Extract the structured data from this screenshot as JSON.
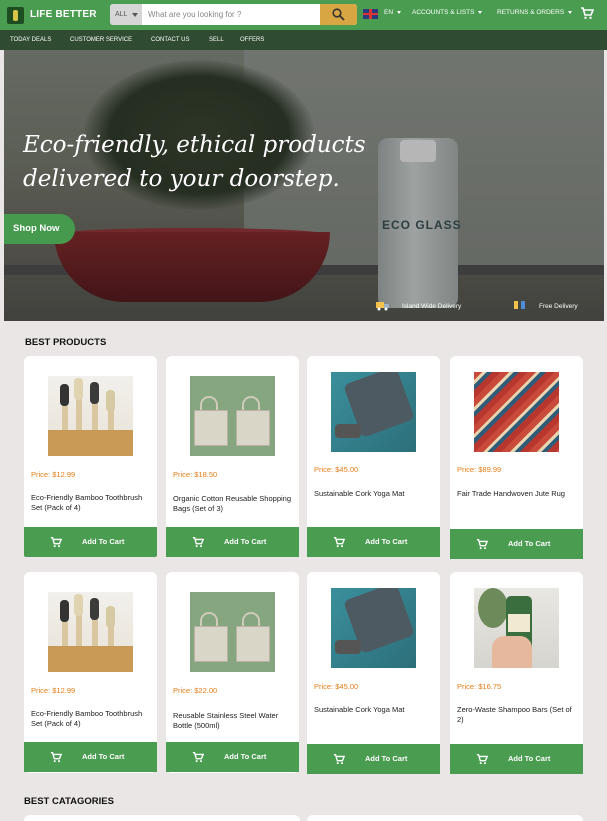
{
  "header": {
    "brand": "LIFE BETTER",
    "search_category": "ALL",
    "search_placeholder": "What are you looking for ?",
    "language": "EN",
    "accounts_label": "ACCOUNTS & LISTS",
    "returns_label": "RETURNS & ORDERS"
  },
  "nav": {
    "items": [
      "TODAY DEALS",
      "CUSTOMER SERVICE",
      "CONTACT US",
      "SELL",
      "OFFERS"
    ]
  },
  "hero": {
    "headline_line1": "Eco-friendly, ethical products",
    "headline_line2": "delivered to your doorstep.",
    "cta_label": "Shop Now",
    "bottle_label": "ECO GLASS",
    "features": [
      "Island Wide Delivery",
      "Free Delivery"
    ]
  },
  "best_products": {
    "title": "BEST PRODUCTS",
    "add_to_cart_label": "Add To Cart",
    "rows": [
      [
        {
          "price": "Price: $12.99",
          "name": "Eco-Friendly Bamboo Toothbrush Set (Pack of 4)",
          "image": "bamboo-toothbrushes"
        },
        {
          "price": "Price: $18.50",
          "name": "Organic Cotton Reusable Shopping Bags (Set of 3)",
          "image": "cotton-bags"
        },
        {
          "price": "Price: $45.00",
          "name": "Sustainable Cork Yoga Mat",
          "image": "yoga-mat"
        },
        {
          "price": "Price: $89.99",
          "name": "Fair Trade Handwoven Jute Rug",
          "image": "jute-rug"
        }
      ],
      [
        {
          "price": "Price: $12.99",
          "name": "Eco-Friendly Bamboo Toothbrush Set (Pack of 4)",
          "image": "bamboo-toothbrushes"
        },
        {
          "price": "Price: $22.00",
          "name": "Reusable Stainless Steel Water Bottle (500ml)",
          "image": "cotton-bags"
        },
        {
          "price": "Price: $45.00",
          "name": "Sustainable Cork Yoga Mat",
          "image": "yoga-mat"
        },
        {
          "price": "Price: $16.75",
          "name": "Zero-Waste Shampoo Bars (Set of 2)",
          "image": "shampoo-bottle"
        }
      ]
    ]
  },
  "best_categories": {
    "title": "BEST CATAGORIES"
  },
  "colors": {
    "brand_green": "#4a9c51",
    "nav_dark_green": "#2f4b31",
    "search_button": "#d8a642",
    "price_orange": "#e47d17",
    "page_bg": "#ebe6e6"
  }
}
